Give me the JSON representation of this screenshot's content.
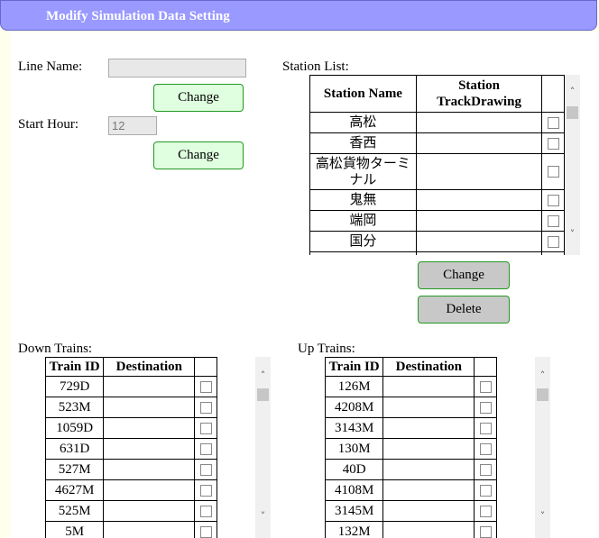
{
  "title": "Modify Simulation Data Setting",
  "line_name": {
    "label": "Line Name:",
    "value": "",
    "button": "Change"
  },
  "start_hour": {
    "label": "Start Hour:",
    "value": "12",
    "button": "Change"
  },
  "station_list": {
    "label": "Station List:",
    "headers": {
      "name": "Station Name",
      "drawing": "Station TrackDrawing"
    },
    "rows": [
      {
        "name": "高松"
      },
      {
        "name": "香西"
      },
      {
        "name": "高松貨物ターミナル"
      },
      {
        "name": "鬼無"
      },
      {
        "name": "端岡"
      },
      {
        "name": "国分"
      }
    ],
    "change_button": "Change",
    "delete_button": "Delete"
  },
  "down_trains": {
    "label": "Down Trains:",
    "headers": {
      "id": "Train ID",
      "dest": "Destination"
    },
    "rows": [
      "729D",
      "523M",
      "1059D",
      "631D",
      "527M",
      "4627M",
      "525M",
      "5M"
    ]
  },
  "up_trains": {
    "label": "Up Trains:",
    "headers": {
      "id": "Train ID",
      "dest": "Destination"
    },
    "rows": [
      "126M",
      "4208M",
      "3143M",
      "130M",
      "40D",
      "4108M",
      "3145M",
      "132M"
    ]
  },
  "icons": {
    "scroll_up": "chevron-up-icon",
    "scroll_down": "chevron-down-icon",
    "checkbox": "checkbox-icon"
  }
}
